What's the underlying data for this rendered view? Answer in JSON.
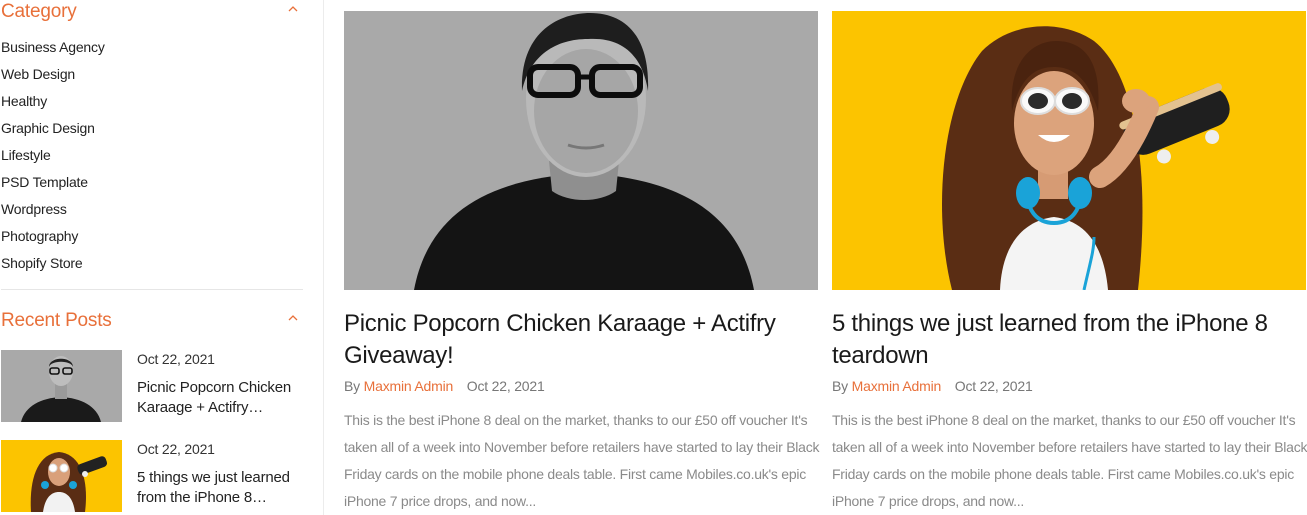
{
  "sidebar": {
    "category": {
      "title": "Category",
      "items": [
        "Business Agency",
        "Web Design",
        "Healthy",
        "Graphic Design",
        "Lifestyle",
        "PSD Template",
        "Wordpress",
        "Photography",
        "Shopify Store"
      ]
    },
    "recent_posts": {
      "title": "Recent Posts",
      "items": [
        {
          "date": "Oct 22, 2021",
          "title": "Picnic Popcorn Chicken Karaage + Actifry…"
        },
        {
          "date": "Oct 22, 2021",
          "title": "5 things we just learned from the iPhone 8…"
        }
      ]
    }
  },
  "posts": [
    {
      "title": "Picnic Popcorn Chicken Karaage + Actifry Giveaway!",
      "by": "By",
      "author": "Maxmin Admin",
      "date": "Oct 22, 2021",
      "excerpt": "This is the best iPhone 8 deal on the market, thanks to our £50 off voucher It's taken all of a week into November before retailers have started to lay their Black Friday cards on the mobile phone deals table. First came Mobiles.co.uk's epic iPhone 7 price drops, and now..."
    },
    {
      "title": "5 things we just learned from the iPhone 8 teardown",
      "by": "By",
      "author": "Maxmin Admin",
      "date": "Oct 22, 2021",
      "excerpt": "This is the best iPhone 8 deal on the market, thanks to our £50 off voucher It's taken all of a week into November before retailers have started to lay their Black Friday cards on the mobile phone deals table. First came Mobiles.co.uk's epic iPhone 7 price drops, and now..."
    }
  ],
  "colors": {
    "accent": "#e8703a",
    "photo_gray_bg": "#a9a9a9",
    "photo_yellow_bg": "#fcc400"
  }
}
